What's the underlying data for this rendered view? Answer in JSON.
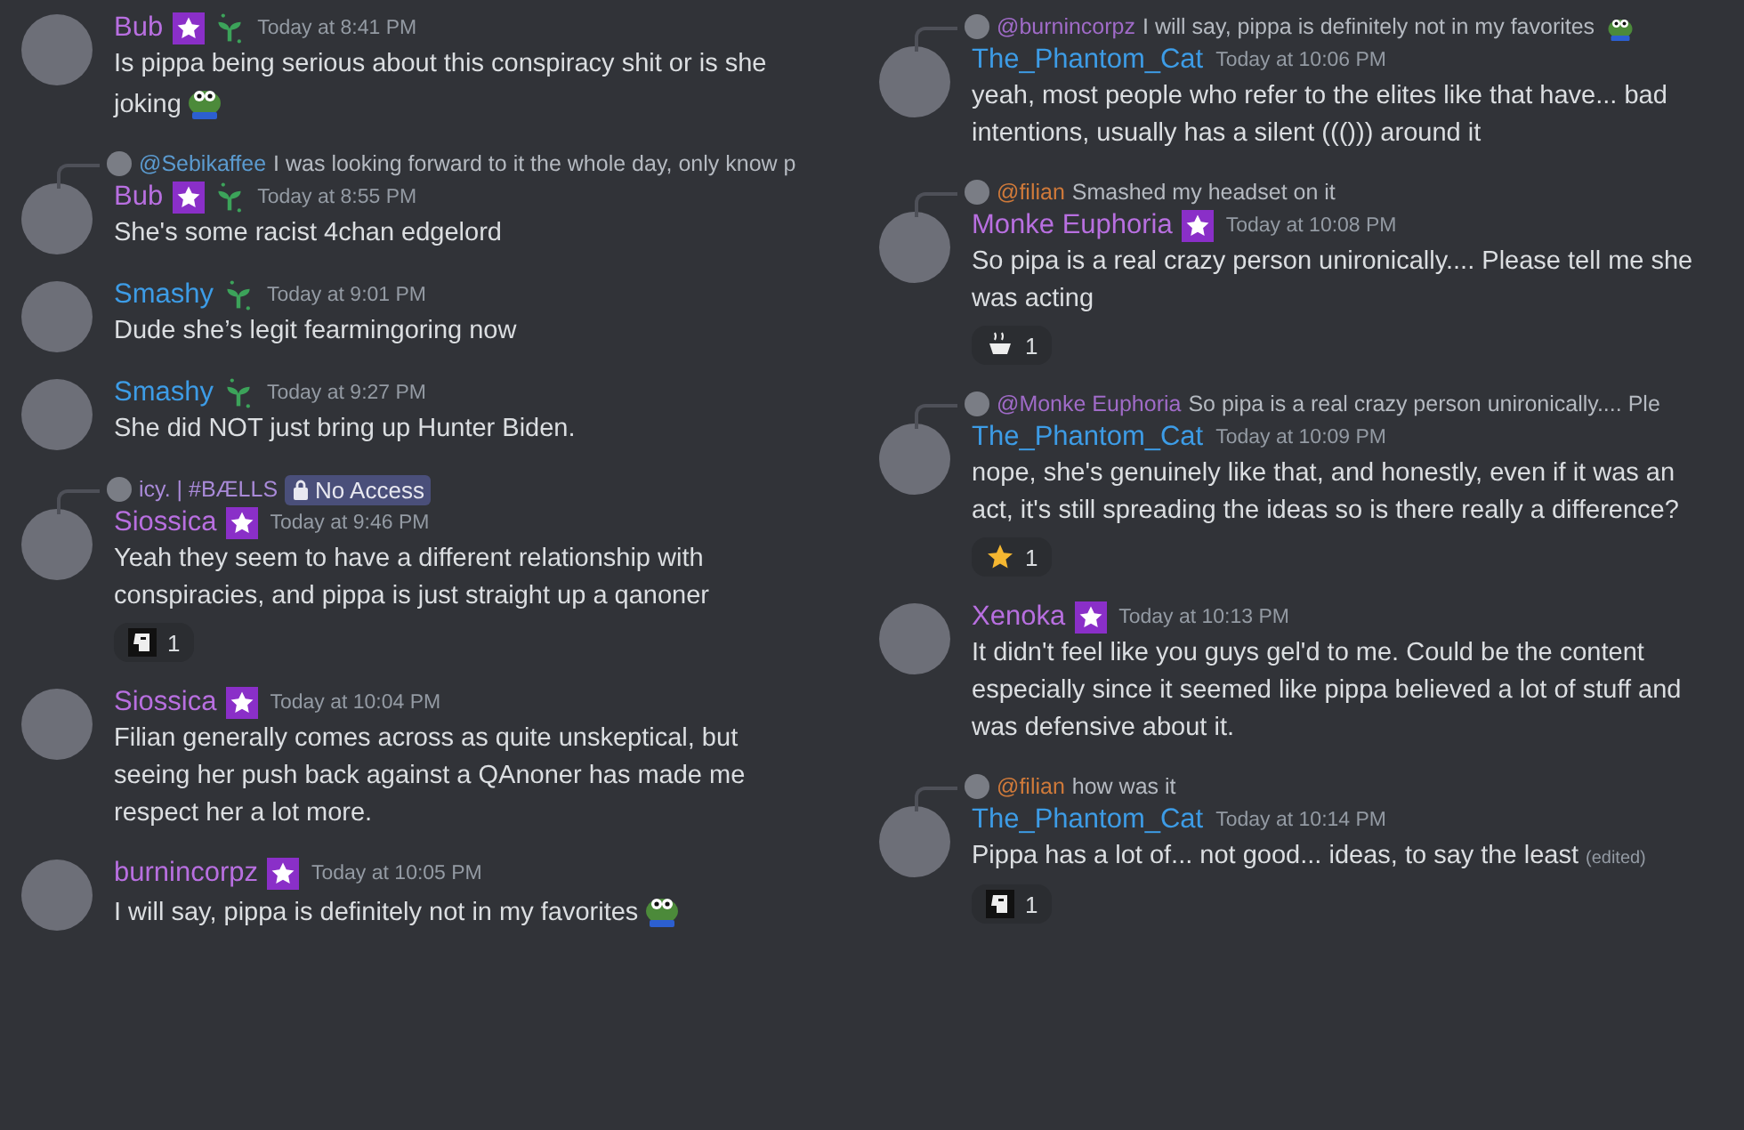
{
  "columns": [
    {
      "messages": [
        {
          "author": "Bub",
          "color": "#b86fe0",
          "badges": [
            {
              "kind": "star"
            },
            {
              "kind": "sprout"
            }
          ],
          "time": "Today at 8:41 PM",
          "text": "Is pippa being serious about this conspiracy shit or is she joking",
          "emoji": {
            "kind": "frog"
          }
        },
        {
          "author": "Bub",
          "color": "#b86fe0",
          "badges": [
            {
              "kind": "star"
            },
            {
              "kind": "sprout"
            }
          ],
          "time": "Today at 8:55 PM",
          "text": "She's some racist 4chan edgelord",
          "reply": {
            "kind": "user",
            "mention": {
              "text": "@Sebikaffee",
              "color": "#5b9bd0"
            },
            "text": "I was looking forward to it the whole day, only know p"
          }
        },
        {
          "author": "Smashy",
          "color": "#3d9ce6",
          "badges": [
            {
              "kind": "sprout"
            }
          ],
          "time": "Today at 9:01 PM",
          "text": "Dude she’s legit fearmingoring now"
        },
        {
          "author": "Smashy",
          "color": "#3d9ce6",
          "badges": [
            {
              "kind": "sprout"
            }
          ],
          "time": "Today at 9:27 PM",
          "text": "She did NOT just bring up Hunter Biden."
        },
        {
          "author": "Siossica",
          "color": "#b86fe0",
          "badges": [
            {
              "kind": "star"
            }
          ],
          "time": "Today at 9:46 PM",
          "text": "Yeah they seem to have a different relationship with conspiracies, and pippa is just straight up a qanoner",
          "reply": {
            "kind": "channel",
            "mention": {
              "text": "icy. | #BÆLLS",
              "color": "#a98ad8"
            },
            "text": "No Access"
          },
          "reactions": [
            {
              "kind": "face",
              "count": "1"
            }
          ]
        },
        {
          "author": "Siossica",
          "color": "#b86fe0",
          "badges": [
            {
              "kind": "star"
            }
          ],
          "time": "Today at 10:04 PM",
          "text": "Filian generally comes across as quite unskeptical, but seeing her push back against a QAnoner has made me respect her a lot more."
        },
        {
          "author": "burnincorpz",
          "color": "#b86fe0",
          "badges": [
            {
              "kind": "star"
            }
          ],
          "time": "Today at 10:05 PM",
          "text": "I will say, pippa is definitely not in my favorites",
          "emoji": {
            "kind": "frog"
          }
        }
      ]
    },
    {
      "messages": [
        {
          "author": "The_Phantom_Cat",
          "color": "#3d9ce6",
          "time": "Today at 10:06 PM",
          "text": "yeah, most people who refer to the elites like that have... bad intentions, usually has a silent ((())) around it",
          "reply": {
            "kind": "user",
            "mention": {
              "text": "@burnincorpz",
              "color": "#a06bc8"
            },
            "text": "I will say, pippa is definitely not in my favorites",
            "emoji": {
              "kind": "frog"
            }
          }
        },
        {
          "author": "Monke Euphoria",
          "color": "#b86fe0",
          "badges": [
            {
              "kind": "star"
            }
          ],
          "time": "Today at 10:08 PM",
          "text": "So pipa is a real crazy person unironically.... Please tell me she  was acting",
          "reply": {
            "kind": "user",
            "mention": {
              "text": "@filian",
              "color": "#d07a3a"
            },
            "text": "Smashed my headset on it"
          },
          "reactions": [
            {
              "kind": "cup",
              "count": "1"
            }
          ]
        },
        {
          "author": "The_Phantom_Cat",
          "color": "#3d9ce6",
          "time": "Today at 10:09 PM",
          "text": "nope, she's genuinely like that, and honestly, even if it was an act, it's still spreading the ideas so is there really a difference?",
          "reply": {
            "kind": "user",
            "mention": {
              "text": "@Monke Euphoria",
              "color": "#a06bc8"
            },
            "text": "So pipa is a real crazy person unironically.... Ple"
          },
          "reactions": [
            {
              "kind": "star",
              "count": "1"
            }
          ]
        },
        {
          "author": "Xenoka",
          "color": "#b86fe0",
          "badges": [
            {
              "kind": "star"
            }
          ],
          "time": "Today at 10:13 PM",
          "text": "It didn't feel like you guys gel'd to me. Could be the content especially since it seemed like pippa believed a lot of stuff and was defensive about it."
        },
        {
          "author": "The_Phantom_Cat",
          "color": "#3d9ce6",
          "time": "Today at 10:14 PM",
          "text": "Pippa has a lot of... not good... ideas, to say the least",
          "edited": "(edited)",
          "reply": {
            "kind": "user",
            "mention": {
              "text": "@filian",
              "color": "#d07a3a"
            },
            "text": "how was it"
          },
          "reactions": [
            {
              "kind": "face",
              "count": "1"
            }
          ]
        }
      ]
    }
  ]
}
